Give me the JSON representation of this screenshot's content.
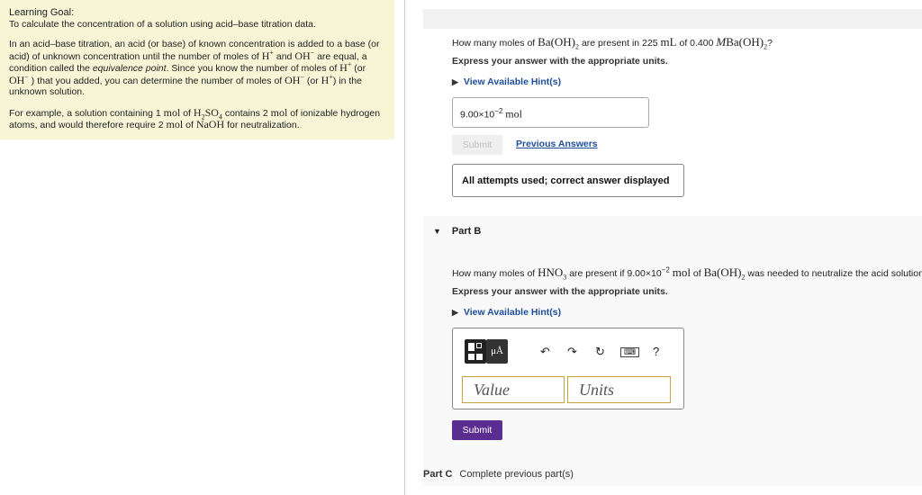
{
  "goal": {
    "title": "Learning Goal:",
    "intro": "To calculate the concentration of a solution using acid–base titration data.",
    "para1": [
      "In an acid–base titration, an acid (or base) of known concentration is added to a base (or",
      "acid) of unknown concentration until the number of moles of",
      "and",
      "are equal, a",
      "condition called the",
      "equivalence point",
      ". Since you know the number of moles of",
      "(or",
      ") that you added, you can determine the number of moles of",
      "(or",
      ") in the",
      "unknown solution."
    ],
    "para2": [
      "For example, a solution containing 1",
      "of",
      "contains 2",
      "of ionizable hydrogen",
      "atoms, and would therefore require 2",
      "of",
      "for neutralization."
    ]
  },
  "partA": {
    "q_pre": "How many moles of",
    "q_mid": "are present in 225",
    "q_mid2": "of 0.400",
    "q_end": "?",
    "instructions": "Express your answer with the appropriate units.",
    "hints_label": "View Available Hint(s)",
    "answer_mantissa": "9.00×10",
    "answer_exp": "−2",
    "answer_unit": "mol",
    "submit_label": "Submit",
    "previous_label": "Previous Answers",
    "status": "All attempts used; correct answer displayed"
  },
  "partB": {
    "label": "Part B",
    "q_pre": "How many moles of",
    "q_mid": "are present if 9.00×10",
    "q_exp": "−2",
    "q_mid2": "of",
    "q_end": "was needed to neutralize the acid solution",
    "instructions": "Express your answer with the appropriate units.",
    "hints_label": "View Available Hint(s)",
    "value_placeholder": "Value",
    "units_placeholder": "Units",
    "mu_label": "μÅ",
    "help_label": "?",
    "submit_label": "Submit"
  },
  "partC": {
    "label": "Part C",
    "text": "Complete previous part(s)"
  },
  "chem": {
    "H": "H",
    "OH": "OH",
    "mol": "mol",
    "mL": "mL",
    "M": "M",
    "Ba": "Ba(OH)",
    "two": "2",
    "H2SO4_a": "H",
    "H2SO4_b": "SO",
    "four": "4",
    "NaOH": "NaOH",
    "HNO": "HNO",
    "three": "3",
    "plus": "+",
    "minus": "−"
  }
}
